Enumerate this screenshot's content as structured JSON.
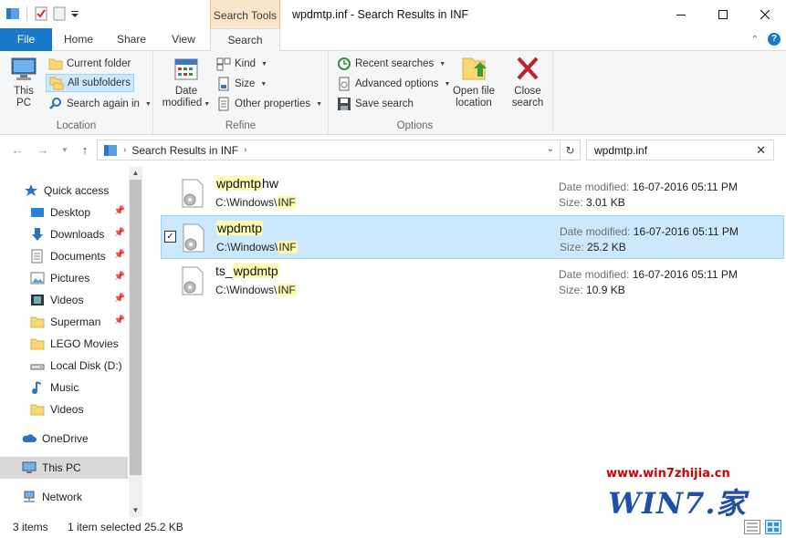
{
  "window": {
    "title": "wpdmtp.inf - Search Results in INF",
    "context_tab": "Search Tools"
  },
  "ribbon_tabs": [
    "File",
    "Home",
    "Share",
    "View",
    "Search"
  ],
  "ribbon": {
    "location": {
      "label": "Location",
      "this_pc": "This\nPC",
      "this_pc_line1": "This",
      "this_pc_line2": "PC",
      "current_folder": "Current folder",
      "all_subfolders": "All subfolders",
      "search_again_in": "Search again in"
    },
    "refine": {
      "label": "Refine",
      "date_modified_1": "Date",
      "date_modified_2": "modified",
      "kind": "Kind",
      "size": "Size",
      "other_properties": "Other properties"
    },
    "options": {
      "label": "Options",
      "recent_searches": "Recent searches",
      "advanced_options": "Advanced options",
      "save_search": "Save search",
      "open_file_location_1": "Open file",
      "open_file_location_2": "location",
      "close_search_1": "Close",
      "close_search_2": "search"
    }
  },
  "address": {
    "path": "Search Results in INF"
  },
  "search": {
    "value": "wpdmtp.inf"
  },
  "nav": [
    {
      "label": "Quick access",
      "icon": "star-icon",
      "pinned": false
    },
    {
      "label": "Desktop",
      "icon": "desktop-icon",
      "pinned": true
    },
    {
      "label": "Downloads",
      "icon": "download-icon",
      "pinned": true
    },
    {
      "label": "Documents",
      "icon": "documents-icon",
      "pinned": true
    },
    {
      "label": "Pictures",
      "icon": "pictures-icon",
      "pinned": true
    },
    {
      "label": "Videos",
      "icon": "videos-icon",
      "pinned": true
    },
    {
      "label": "Superman",
      "icon": "folder-icon",
      "pinned": true
    },
    {
      "label": "LEGO Movies",
      "icon": "folder-icon",
      "pinned": false
    },
    {
      "label": "Local Disk (D:)",
      "icon": "drive-icon",
      "pinned": false
    },
    {
      "label": "Music",
      "icon": "music-icon",
      "pinned": false
    },
    {
      "label": "Videos",
      "icon": "folder-icon",
      "pinned": false
    },
    {
      "label": "OneDrive",
      "icon": "cloud-icon",
      "pinned": false
    },
    {
      "label": "This PC",
      "icon": "computer-icon",
      "pinned": false
    },
    {
      "label": "Network",
      "icon": "network-icon",
      "pinned": false
    }
  ],
  "results": [
    {
      "name_pre": "",
      "name_hl": "wpdmtp",
      "name_post": "hw",
      "path_pre": "C:\\Windows\\",
      "path_hl": "INF",
      "date_label": "Date modified:",
      "date": "16-07-2016 05:11 PM",
      "size_label": "Size:",
      "size": "3.01 KB",
      "selected": false
    },
    {
      "name_pre": "",
      "name_hl": "wpdmtp",
      "name_post": "",
      "path_pre": "C:\\Windows\\",
      "path_hl": "INF",
      "date_label": "Date modified:",
      "date": "16-07-2016 05:11 PM",
      "size_label": "Size:",
      "size": "25.2 KB",
      "selected": true
    },
    {
      "name_pre": "ts_",
      "name_hl": "wpdmtp",
      "name_post": "",
      "path_pre": "C:\\Windows\\",
      "path_hl": "INF",
      "date_label": "Date modified:",
      "date": "16-07-2016 05:11 PM",
      "size_label": "Size:",
      "size": "10.9 KB",
      "selected": false
    }
  ],
  "status": {
    "items": "3 items",
    "selected": "1 item selected  25.2 KB"
  },
  "watermark": {
    "url": "www.win7zhijia.cn",
    "logo": "WIN7.",
    "logo_char": "家"
  },
  "colors": {
    "file_tab": "#1979ca",
    "context_tab": "#fbe5c8",
    "selection": "#cce8ff",
    "highlight": "#fffbb0"
  }
}
